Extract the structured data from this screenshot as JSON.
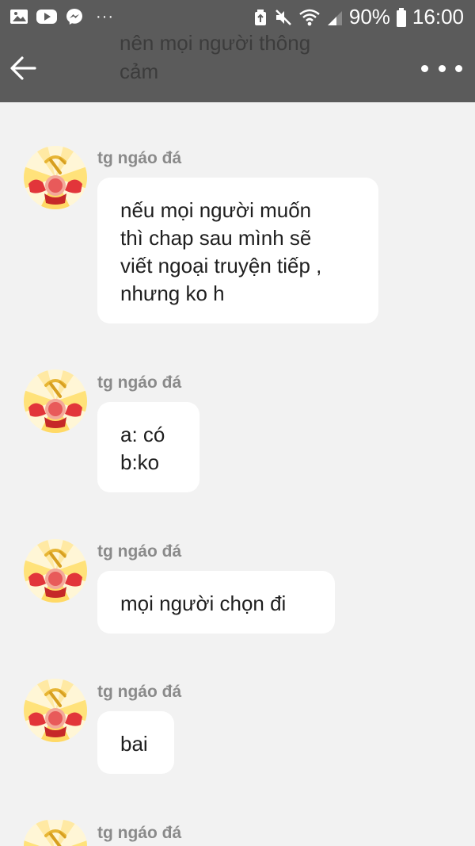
{
  "status_bar": {
    "notification_icons": [
      "gallery-icon",
      "youtube-icon",
      "messenger-icon"
    ],
    "more_dots": "···",
    "battery_percent": "90%",
    "time": "16:00"
  },
  "header": {
    "behind_text": "nên mọi người thông\ncảm"
  },
  "messages": [
    {
      "sender": "tg ngáo đá",
      "text": "nếu mọi người muốn\nthì chap sau mình sẽ\nviết ngoại truyện tiếp ,\nnhưng ko h"
    },
    {
      "sender": "tg ngáo đá",
      "text": "a: có\nb:ko"
    },
    {
      "sender": "tg ngáo đá",
      "text": "mọi người chọn đi"
    },
    {
      "sender": "tg ngáo đá",
      "text": "bai"
    },
    {
      "sender": "tg ngáo đá",
      "text": ""
    }
  ],
  "colors": {
    "header_bg": "#5b5b5b",
    "page_bg": "#f2f2f2",
    "bubble_bg": "#ffffff"
  }
}
